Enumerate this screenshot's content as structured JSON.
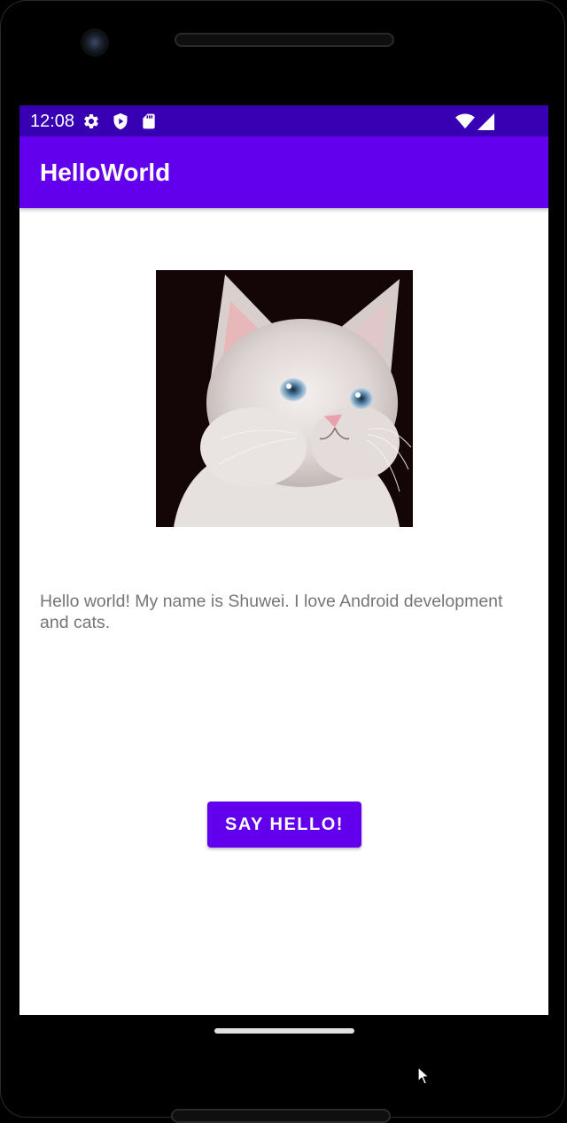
{
  "status_bar": {
    "time": "12:08",
    "left_icons": [
      "settings-icon",
      "shield-icon",
      "sd-card-icon"
    ],
    "right_icons": [
      "wifi-icon",
      "cell-signal-icon"
    ],
    "color": "#3700b3"
  },
  "app_bar": {
    "title": "HelloWorld",
    "color": "#6200ee"
  },
  "main": {
    "image_alt_name": "kitten",
    "intro_text": "Hello world! My name is Shuwei. I love Android development and cats.",
    "button_label": "SAY HELLO!"
  },
  "colors": {
    "accent": "#6200ee",
    "text_secondary": "#757575",
    "background": "#ffffff"
  }
}
